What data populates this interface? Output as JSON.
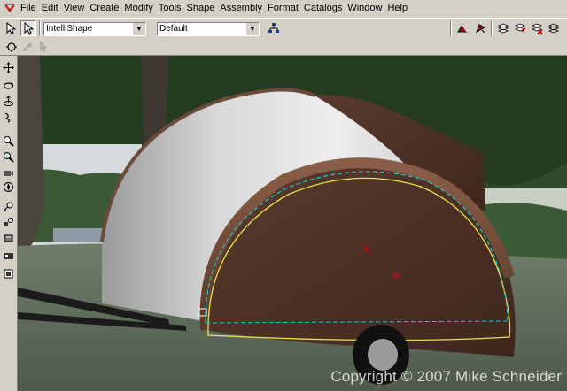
{
  "menu": {
    "app_icon": "truespace-logo-icon",
    "items": [
      {
        "first": "F",
        "rest": "ile"
      },
      {
        "first": "E",
        "rest": "dit"
      },
      {
        "first": "V",
        "rest": "iew"
      },
      {
        "first": "C",
        "rest": "reate"
      },
      {
        "first": "M",
        "rest": "odify"
      },
      {
        "first": "T",
        "rest": "ools"
      },
      {
        "first": "S",
        "rest": "hape"
      },
      {
        "first": "A",
        "rest": "ssembly"
      },
      {
        "first": "F",
        "rest": "ormat"
      },
      {
        "first": "C",
        "rest": "atalogs"
      },
      {
        "first": "W",
        "rest": "indow"
      },
      {
        "first": "H",
        "rest": "elp"
      }
    ]
  },
  "toolbar": {
    "shape_combo": "IntelliShape",
    "style_combo": "Default"
  },
  "viewport": {
    "watermark": "Copyright © 2007 Mike Schneider"
  },
  "colors": {
    "chrome": "#d4d0c8",
    "trailer_brown": "#4a2d22",
    "trailer_white": "#e6e6e6",
    "outline_cyan": "#17c9c9",
    "outline_yellow": "#e8e24a"
  }
}
